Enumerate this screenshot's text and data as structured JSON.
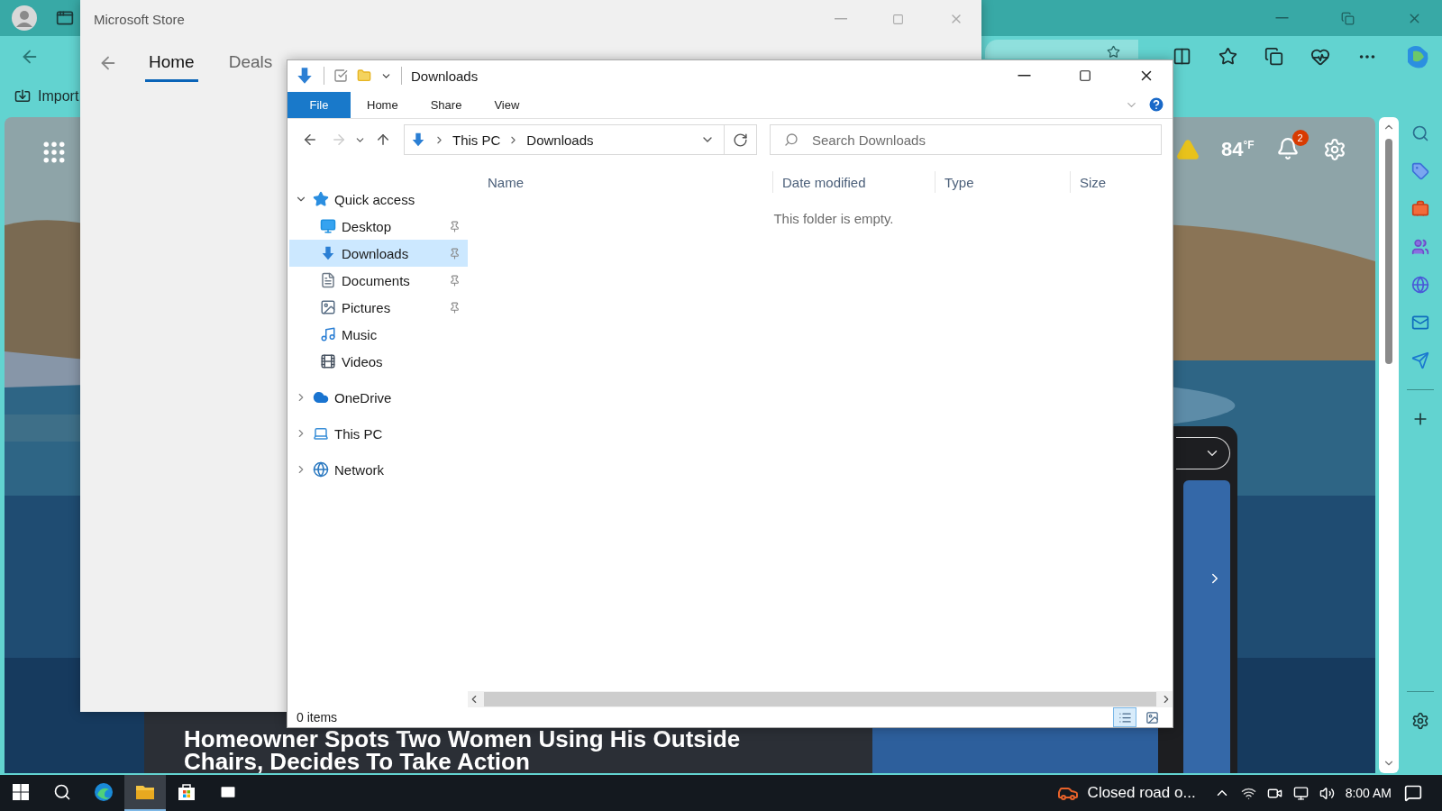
{
  "browser": {
    "favorites": [
      {
        "label": "Import"
      }
    ],
    "weather": {
      "temperature": "84$^{°F}$"
    },
    "notifications": {
      "count": "2"
    },
    "headline": "Homeowner Spots Two Women Using His Outside Chairs, Decides To Take Action"
  },
  "store_window": {
    "title": "Microsoft Store",
    "tabs": [
      {
        "label": "Home",
        "selected": true
      },
      {
        "label": "Deals",
        "selected": false
      }
    ]
  },
  "explorer": {
    "title": "Downloads",
    "file_menu": "File",
    "ribbon_tabs": [
      "Home",
      "Share",
      "View"
    ],
    "breadcrumb": [
      "This PC",
      "Downloads"
    ],
    "search": {
      "placeholder": "Search Downloads"
    },
    "columns": [
      "Name",
      "Date modified",
      "Type",
      "Size"
    ],
    "empty_message": "This folder is empty.",
    "nav": [
      {
        "label": "Quick access",
        "kind": "star",
        "expanded": true,
        "selected": false,
        "children": [
          {
            "label": "Desktop",
            "kind": "desktop",
            "pinned": true,
            "selected": false
          },
          {
            "label": "Downloads",
            "kind": "download",
            "pinned": true,
            "selected": true
          },
          {
            "label": "Documents",
            "kind": "document",
            "pinned": true,
            "selected": false
          },
          {
            "label": "Pictures",
            "kind": "pictures",
            "pinned": true,
            "selected": false
          },
          {
            "label": "Music",
            "kind": "music",
            "pinned": false,
            "selected": false
          },
          {
            "label": "Videos",
            "kind": "videos",
            "pinned": false,
            "selected": false
          }
        ]
      },
      {
        "label": "OneDrive",
        "kind": "cloud",
        "expanded": false,
        "selected": false
      },
      {
        "label": "This PC",
        "kind": "pc",
        "expanded": false,
        "selected": false
      },
      {
        "label": "Network",
        "kind": "network",
        "expanded": false,
        "selected": false
      }
    ],
    "status": "0 items"
  },
  "taskbar": {
    "apps": [
      {
        "kind": "edge",
        "selected": false
      },
      {
        "kind": "explorer",
        "selected": true
      },
      {
        "kind": "store",
        "selected": false
      },
      {
        "kind": "mail",
        "selected": false
      }
    ],
    "notification": "Closed road o...",
    "time": "8:00 AM"
  }
}
